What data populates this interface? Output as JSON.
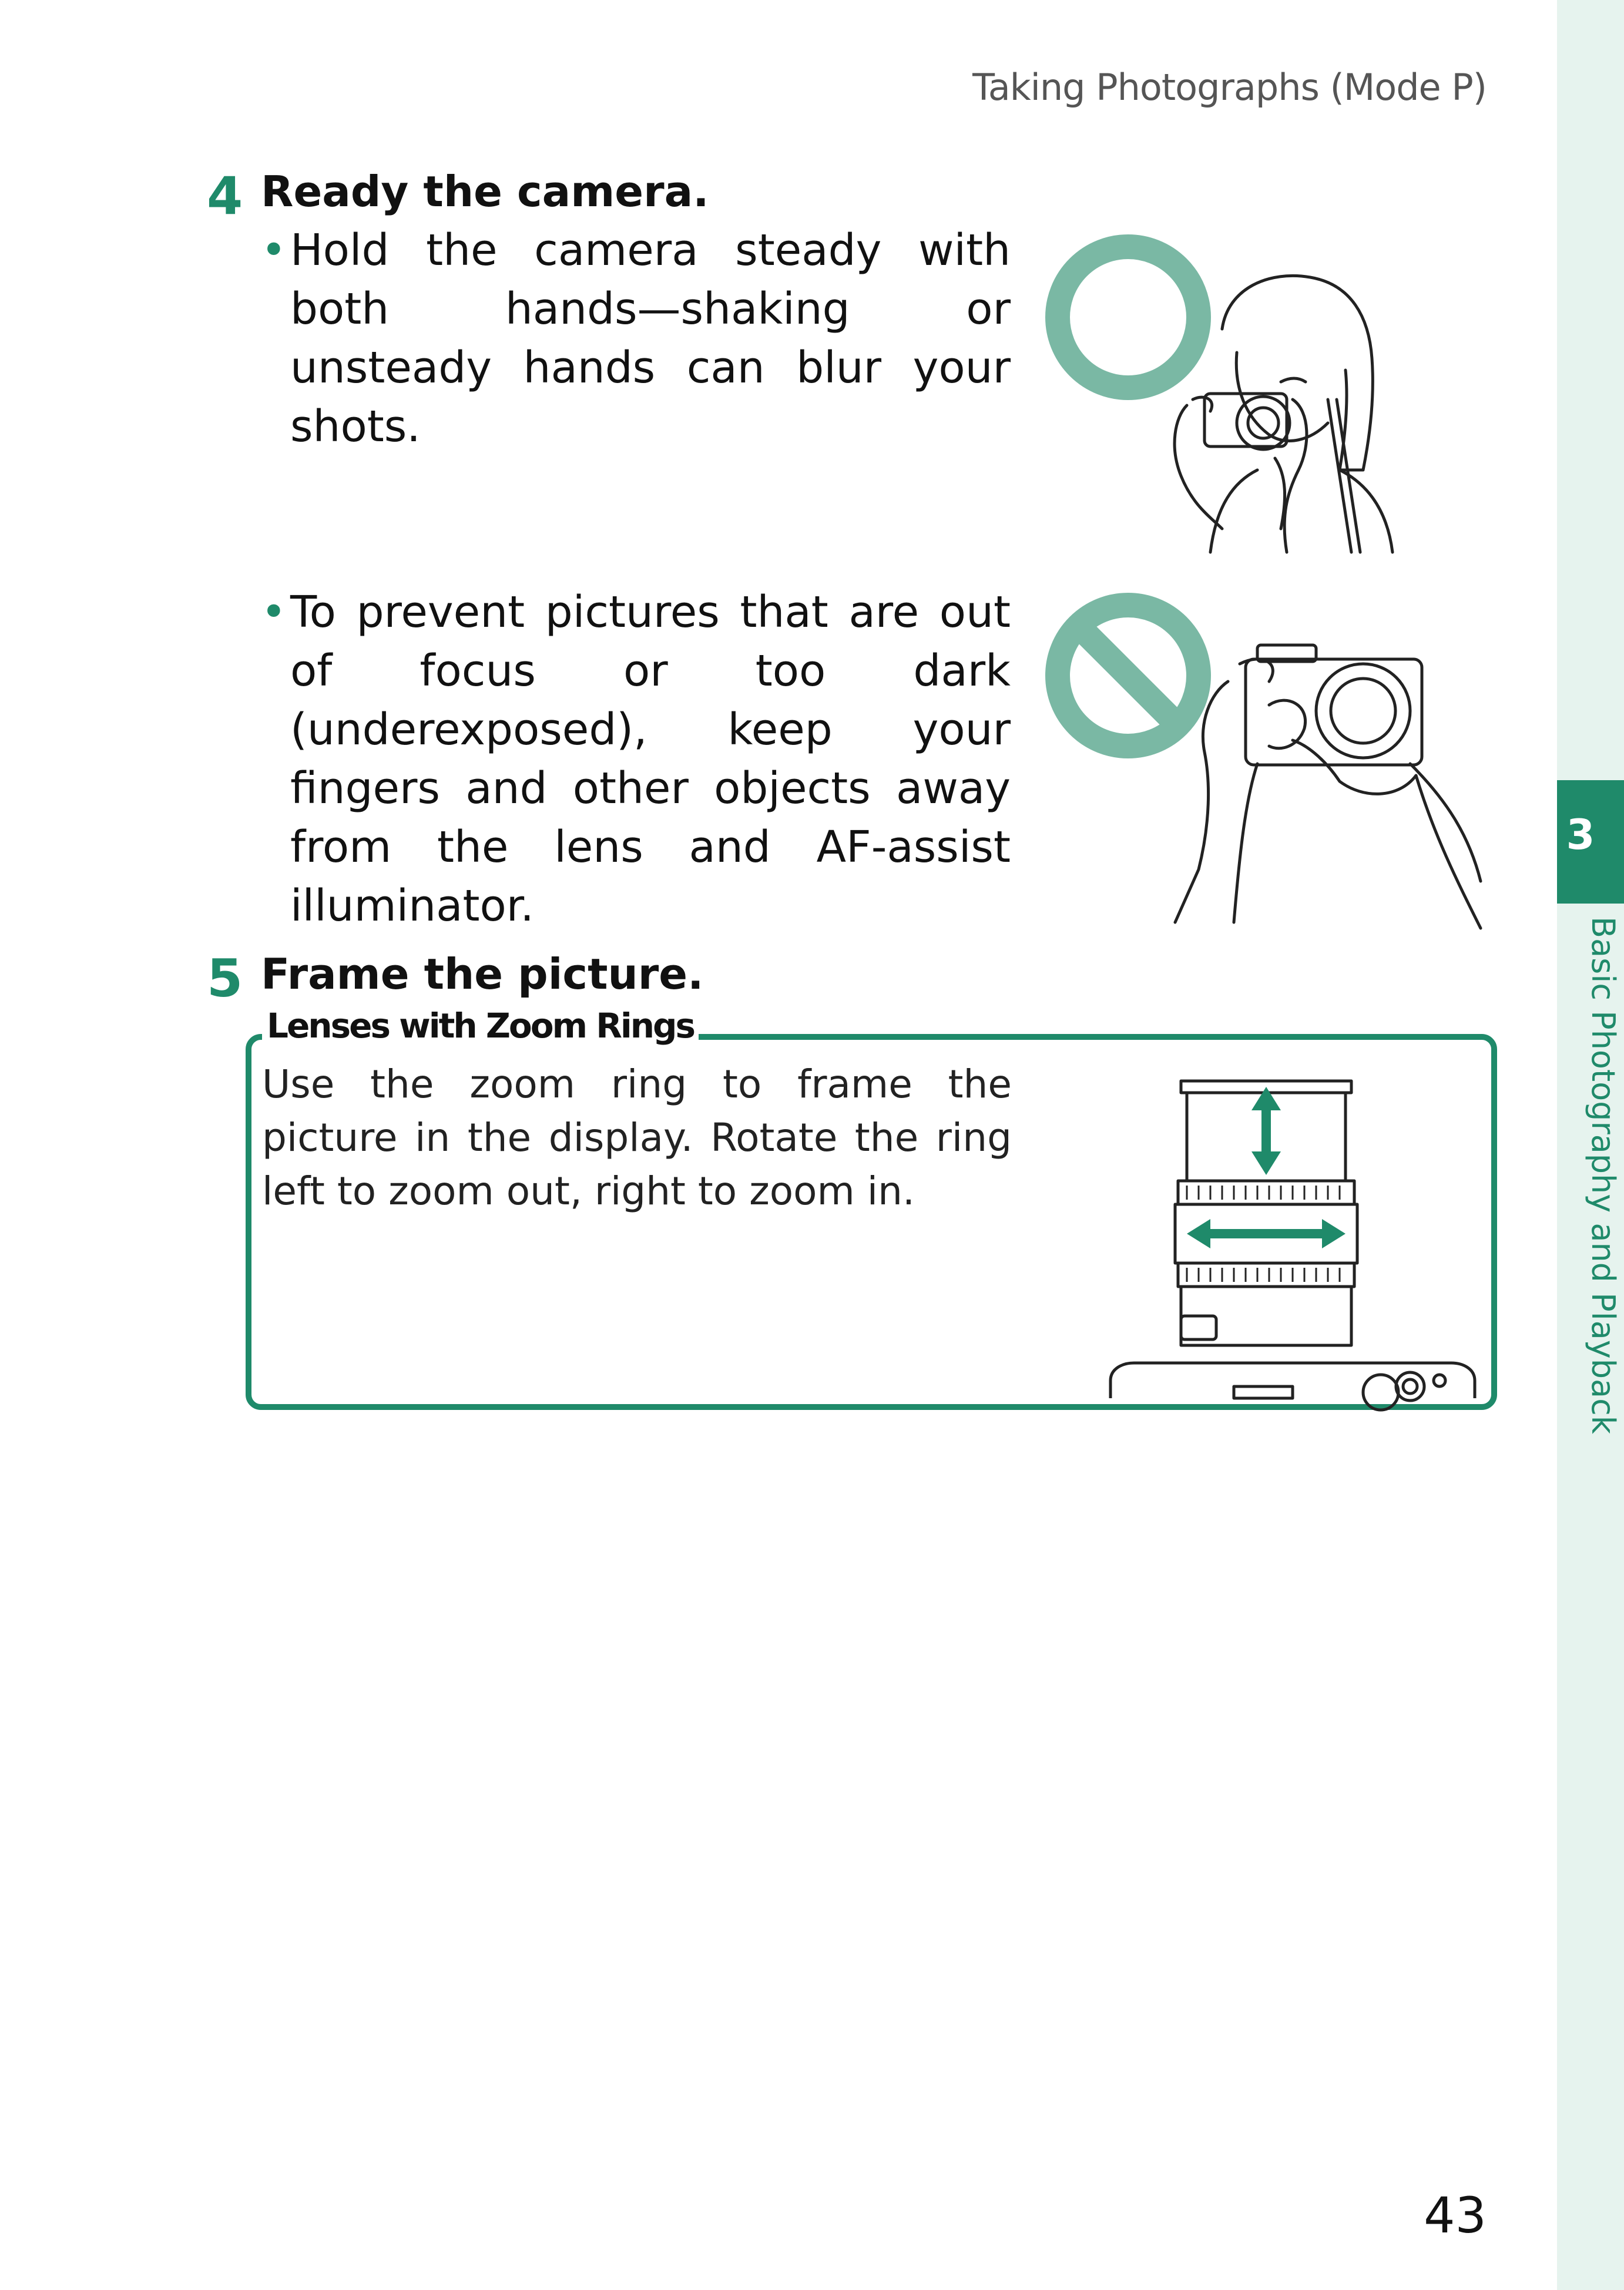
{
  "header": {
    "running_title": "Taking Photographs (Mode P)"
  },
  "steps": [
    {
      "number": "4",
      "title": "Ready the camera.",
      "bullets": [
        "Hold the camera steady with both hands—shaking or unsteady hands can blur your shots.",
        "To prevent pictures that are out of focus or too dark (underexposed), keep your fingers and other objects away from the lens and AF-assist illuminator."
      ]
    },
    {
      "number": "5",
      "title": "Frame the picture."
    }
  ],
  "note": {
    "title": "Lenses with Zoom Rings",
    "body": "Use the zoom ring to frame the picture in the display. Rotate the ring left to zoom out, right to zoom in."
  },
  "side_tab": {
    "chapter_number": "3",
    "chapter_title": "Basic Photography and Playback"
  },
  "page_number": "43",
  "colors": {
    "accent": "#1f8a6a",
    "symbol": "#7ab8a4",
    "tab_background": "#e6f3ee"
  },
  "illustrations": [
    {
      "icon": "correct-circle-icon",
      "depicts": "woman holding camera with both hands"
    },
    {
      "icon": "prohibited-icon",
      "depicts": "finger covering lens"
    },
    {
      "icon": "zoom-ring-icon",
      "depicts": "lens with zoom ring arrows"
    }
  ]
}
